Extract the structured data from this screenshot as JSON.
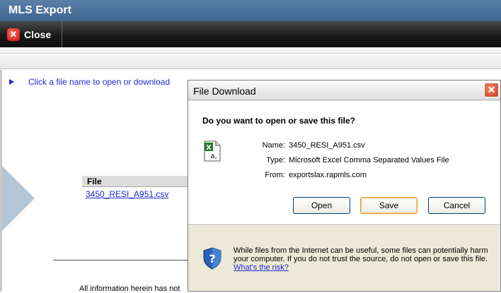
{
  "app": {
    "title": "MLS Export"
  },
  "toolbar": {
    "close_label": "Close"
  },
  "page": {
    "instruction": "Click a file name to open or download",
    "table": {
      "header": "File",
      "files": [
        "3450_RESI_A951.csv"
      ]
    },
    "disclaimer": "All information herein has not"
  },
  "dialog": {
    "title": "File Download",
    "question": "Do you want to open or save this file?",
    "name_label": "Name:",
    "name_value": "3450_RESI_A951.csv",
    "type_label": "Type:",
    "type_value": "Microsoft Excel Comma Separated Values File",
    "from_label": "From:",
    "from_value": "exportslax.rapmls.com",
    "buttons": {
      "open": "Open",
      "save": "Save",
      "cancel": "Cancel"
    },
    "warning_text": "While files from the Internet can be useful, some files can potentially harm your computer. If you do not trust the source, do not open or save this file.",
    "risk_link": "What's the risk?"
  },
  "icons": {
    "close": "close-icon",
    "file": "excel-csv-file-icon",
    "shield": "shield-question-icon"
  },
  "colors": {
    "link": "#1f2bd0",
    "title_bar": "#3d6592",
    "toolbar": "#1a1a1a"
  }
}
